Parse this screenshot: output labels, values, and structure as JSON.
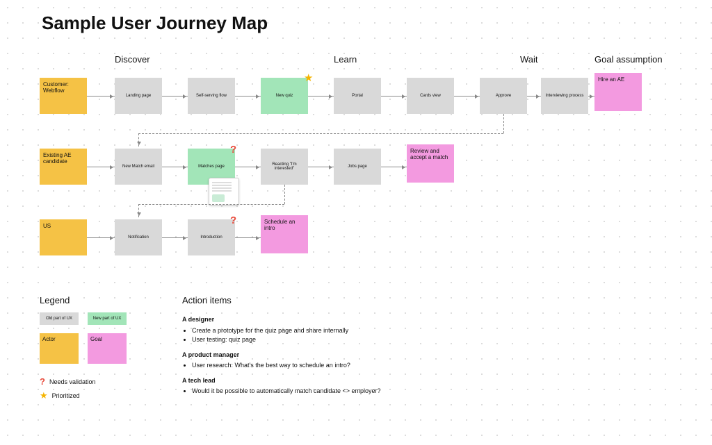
{
  "title": "Sample User Journey Map",
  "stages": {
    "discover": "Discover",
    "learn": "Learn",
    "wait": "Wait",
    "goal": "Goal assumption"
  },
  "rows": {
    "customer": {
      "actor": "Customer: Webflow",
      "steps": [
        "Landing page",
        "Self-serving flow",
        "New quiz",
        "Portal",
        "Cards view",
        "Approve",
        "Interviewing process"
      ],
      "goal": "Hire an AE"
    },
    "candidate": {
      "actor": "Existing AE candidate",
      "steps": [
        "New Match email",
        "Matches page",
        "Reacting \"I'm interested\"",
        "Jobs page"
      ],
      "goal": "Review and accept a match"
    },
    "us": {
      "actor": "US",
      "steps": [
        "Notification",
        "Introduction"
      ],
      "goal": "Schedule an intro"
    }
  },
  "legend": {
    "title": "Legend",
    "old_ux": "Old part of UX",
    "new_ux": "New part of UX",
    "actor": "Actor",
    "goal": "Goal",
    "needs_validation": "Needs validation",
    "prioritized": "Prioritized"
  },
  "actions": {
    "title": "Action items",
    "groups": [
      {
        "role": "A designer",
        "items": [
          "Create a prototype for the quiz page and share internally",
          "User testing: quiz page"
        ]
      },
      {
        "role": "A product manager",
        "items": [
          "User research: What's the best way to schedule an intro?"
        ]
      },
      {
        "role": "A tech lead",
        "items": [
          "Would it be possible to automatically match candidate <> employer?"
        ]
      }
    ]
  }
}
